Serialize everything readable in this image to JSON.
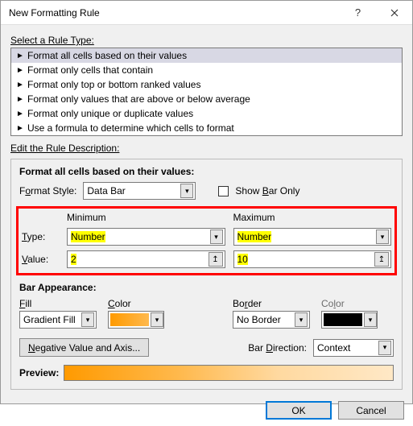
{
  "title": "New Formatting Rule",
  "select_rule_label": "Select a Rule Type:",
  "rule_types": [
    "Format all cells based on their values",
    "Format only cells that contain",
    "Format only top or bottom ranked values",
    "Format only values that are above or below average",
    "Format only unique or duplicate values",
    "Use a formula to determine which cells to format"
  ],
  "edit_desc_label": "Edit the Rule Description:",
  "desc": {
    "heading": "Format all cells based on their values:",
    "format_style_label": "Format Style:",
    "format_style_value": "Data Bar",
    "show_bar_only": "Show Bar Only",
    "min_label": "Minimum",
    "max_label": "Maximum",
    "type_label": "Type:",
    "value_label": "Value:",
    "type_min": "Number",
    "type_max": "Number",
    "value_min": "2",
    "value_max": "10",
    "bar_appearance": "Bar Appearance:",
    "fill_label": "Fill",
    "color_label": "Color",
    "border_label": "Border",
    "fill_value": "Gradient Fill",
    "border_value": "No Border",
    "neg_btn": "Negative Value and Axis...",
    "bar_dir_label": "Bar Direction:",
    "bar_dir_value": "Context",
    "preview_label": "Preview:"
  },
  "footer": {
    "ok": "OK",
    "cancel": "Cancel"
  }
}
